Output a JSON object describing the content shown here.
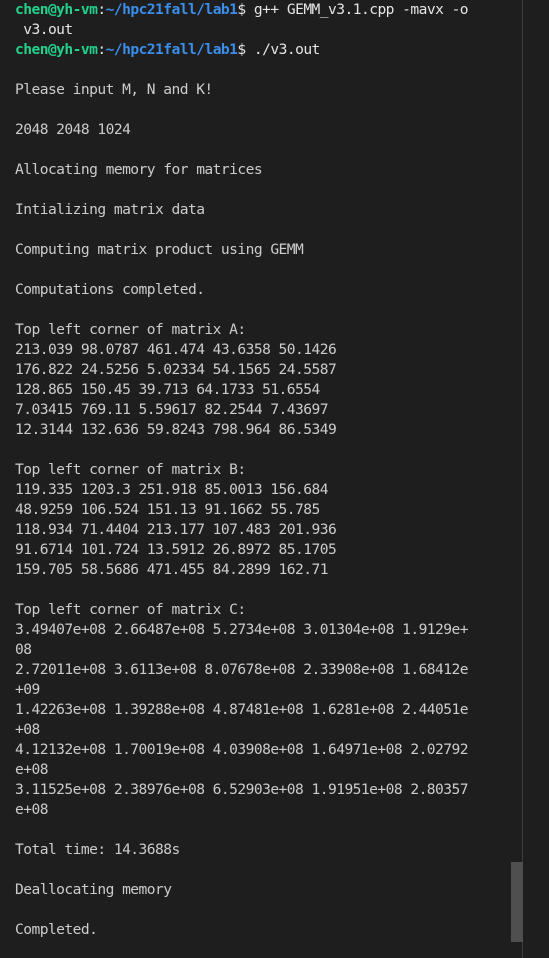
{
  "prompt": {
    "user_host": "chen@yh-vm",
    "separator": ":",
    "path": "~/hpc21fall/lab1",
    "symbol": "$"
  },
  "commands": {
    "compile": "g++ GEMM_v3.1.cpp -mavx -o",
    "compile_cont": " v3.out",
    "run": "./v3.out"
  },
  "output": {
    "input_prompt": "Please input M, N and K!",
    "input_values": "2048 2048 1024",
    "allocating": "Allocating memory for matrices",
    "initializing": "Intializing matrix data",
    "computing": "Computing matrix product using GEMM",
    "completed_compute": "Computations completed.",
    "matrix_a_title": "Top left corner of matrix A:",
    "matrix_a_rows": [
      "213.039 98.0787 461.474 43.6358 50.1426",
      "176.822 24.5256 5.02334 54.1565 24.5587",
      "128.865 150.45 39.713 64.1733 51.6554",
      "7.03415 769.11 5.59617 82.2544 7.43697",
      "12.3144 132.636 59.8243 798.964 86.5349"
    ],
    "matrix_b_title": "Top left corner of matrix B:",
    "matrix_b_rows": [
      "119.335 1203.3 251.918 85.0013 156.684",
      "48.9259 106.524 151.13 91.1662 55.785",
      "118.934 71.4404 213.177 107.483 201.936",
      "91.6714 101.724 13.5912 26.8972 85.1705",
      "159.705 58.5686 471.455 84.2899 162.71"
    ],
    "matrix_c_title": "Top left corner of matrix C:",
    "matrix_c_lines": [
      "3.49407e+08 2.66487e+08 5.2734e+08 3.01304e+08 1.9129e+",
      "08",
      "2.72011e+08 3.6113e+08 8.07678e+08 2.33908e+08 1.68412e",
      "+09",
      "1.42263e+08 1.39288e+08 4.87481e+08 1.6281e+08 2.44051e",
      "+08",
      "4.12132e+08 1.70019e+08 4.03908e+08 1.64971e+08 2.02792",
      "e+08",
      "3.11525e+08 2.38976e+08 6.52903e+08 1.91951e+08 2.80357",
      "e+08"
    ],
    "total_time": "Total time: 14.3688s",
    "deallocating": "Deallocating memory",
    "completed": "Completed."
  }
}
